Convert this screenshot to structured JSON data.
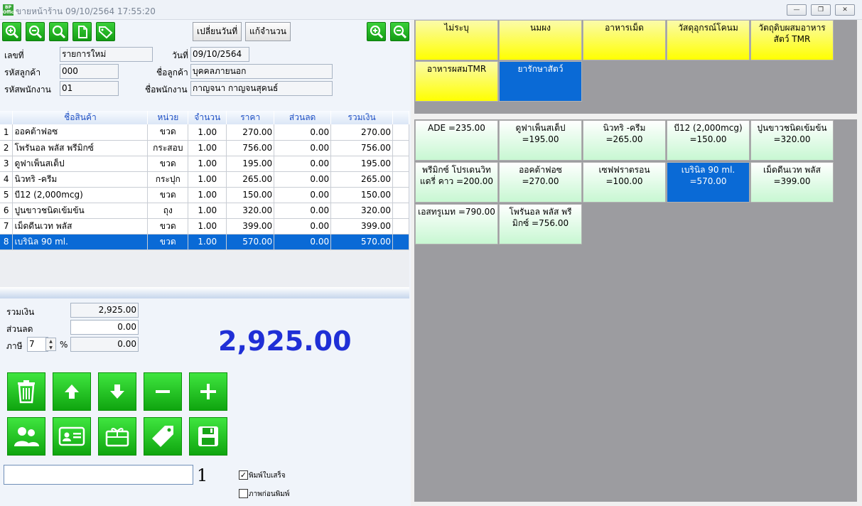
{
  "window": {
    "title": "ขายหน้าร้าน 09/10/2564 17:55:20",
    "icon_text": "BP Office",
    "minimize": "—",
    "restore": "❐",
    "close": "✕"
  },
  "toolbar": {
    "change_date_label": "เปลี่ยนวันที่",
    "edit_qty_label": "แก้จำนวน"
  },
  "header": {
    "doc_no_label": "เลขที่",
    "doc_no_value": "รายการใหม่",
    "date_label": "วันที่",
    "date_value": "09/10/2564",
    "cust_code_label": "รหัสลูกค้า",
    "cust_code_value": "000",
    "cust_name_label": "ชื่อลูกค้า",
    "cust_name_value": "บุคคลภายนอก",
    "emp_code_label": "รหัสพนักงาน",
    "emp_code_value": "01",
    "emp_name_label": "ชื่อพนักงาน",
    "emp_name_value": "กาญจนา กาญจนสุคนธ์"
  },
  "grid": {
    "columns": [
      "ชื่อสินค้า",
      "หน่วย",
      "จำนวน",
      "ราคา",
      "ส่วนลด",
      "รวมเงิน"
    ],
    "rows": [
      {
        "no": "1",
        "name": "ออคต้าฟอซ",
        "unit": "ขวด",
        "qty": "1.00",
        "price": "270.00",
        "discount": "0.00",
        "total": "270.00"
      },
      {
        "no": "2",
        "name": "โพรันอล พลัส พรีมิกซ์",
        "unit": "กระสอบ",
        "qty": "1.00",
        "price": "756.00",
        "discount": "0.00",
        "total": "756.00"
      },
      {
        "no": "3",
        "name": "ดูฟาเพ็นสเต็ป",
        "unit": "ขวด",
        "qty": "1.00",
        "price": "195.00",
        "discount": "0.00",
        "total": "195.00"
      },
      {
        "no": "4",
        "name": "นิวทริ -ครีม",
        "unit": "กระปุก",
        "qty": "1.00",
        "price": "265.00",
        "discount": "0.00",
        "total": "265.00"
      },
      {
        "no": "5",
        "name": "บี12 (2,000mcg)",
        "unit": "ขวด",
        "qty": "1.00",
        "price": "150.00",
        "discount": "0.00",
        "total": "150.00"
      },
      {
        "no": "6",
        "name": "ปูนขาวชนิดเข้มข้น",
        "unit": "ถุง",
        "qty": "1.00",
        "price": "320.00",
        "discount": "0.00",
        "total": "320.00"
      },
      {
        "no": "7",
        "name": "เม็ดดีนเวท พลัส",
        "unit": "ขวด",
        "qty": "1.00",
        "price": "399.00",
        "discount": "0.00",
        "total": "399.00"
      },
      {
        "no": "8",
        "name": "เบรินิล 90 ml.",
        "unit": "ขวด",
        "qty": "1.00",
        "price": "570.00",
        "discount": "0.00",
        "total": "570.00"
      }
    ]
  },
  "summary": {
    "total_label": "รวมเงิน",
    "total_value": "2,925.00",
    "discount_label": "ส่วนลด",
    "discount_value": "0.00",
    "tax_label": "ภาษี",
    "tax_rate": "7",
    "tax_unit": "%",
    "tax_value": "0.00",
    "grand_total": "2,925.00"
  },
  "footer": {
    "barcode_input_value": "",
    "quantity": "1",
    "print_receipt_label": "พิมพ์ใบเสร็จ",
    "print_receipt_checked": true,
    "preview_label": "ภาพก่อนพิมพ์",
    "preview_checked": false
  },
  "categories": [
    {
      "label": "ไม่ระบุ",
      "selected": false
    },
    {
      "label": "นมผง",
      "selected": false
    },
    {
      "label": "อาหารเม็ด",
      "selected": false
    },
    {
      "label": "วัสดุอุกรณ์โคนม",
      "selected": false
    },
    {
      "label": "วัตถุดิบผสมอาหาร สัตว์ TMR",
      "selected": false
    },
    {
      "label": "อาหารผสมTMR",
      "selected": false
    },
    {
      "label": "ยารักษาสัตว์",
      "selected": true
    }
  ],
  "products": [
    {
      "label": "ADE =235.00",
      "selected": false
    },
    {
      "label": "ดูฟาเพ็นสเต็ป =195.00",
      "selected": false
    },
    {
      "label": "นิวทริ -ครีม =265.00",
      "selected": false
    },
    {
      "label": "บี12 (2,000mcg) =150.00",
      "selected": false
    },
    {
      "label": "ปูนขาวชนิดเข้มข้น =320.00",
      "selected": false
    },
    {
      "label": "พรีมิกซ์ โปรเดนวิท แดรี่ คาว =200.00",
      "selected": false
    },
    {
      "label": "ออคต้าฟอซ =270.00",
      "selected": false
    },
    {
      "label": "เซฟฟราตรอน =100.00",
      "selected": false
    },
    {
      "label": "เบรินิล 90 ml. =570.00",
      "selected": true
    },
    {
      "label": "เม็ดดีนเวท พลัส =399.00",
      "selected": false
    },
    {
      "label": "เอสทรูเมท =790.00",
      "selected": false
    },
    {
      "label": "โพรันอล พลัส พรี มิกซ์ =756.00",
      "selected": false
    }
  ],
  "colors": {
    "accent_green": "#149c14",
    "selection_blue": "#0a6ad6",
    "category_yellow": "#ffff00",
    "product_green": "#c8f7d2",
    "grand_total_blue": "#1f2fd6"
  }
}
